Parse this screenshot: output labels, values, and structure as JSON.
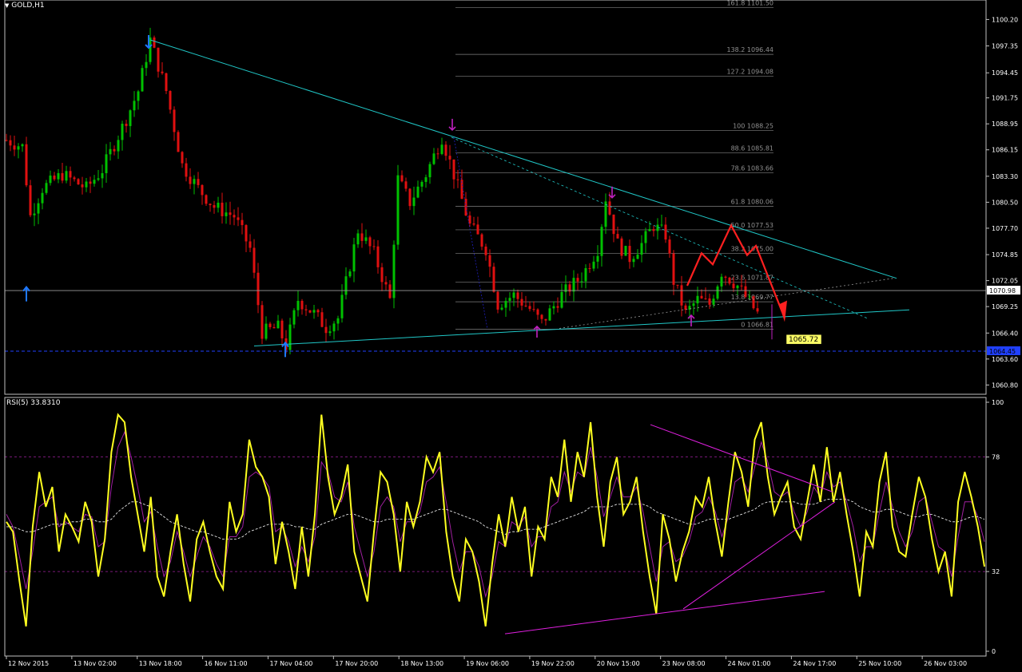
{
  "colors": {
    "background": "#000000",
    "frame": "#c0c0c0",
    "bull": "#00c000",
    "bear": "#e01010",
    "trendline": "#20c8c8",
    "fibo": "#808080",
    "projection": "#ff2020",
    "rsi": "#ffff20",
    "rsi_signal": "#a020a0",
    "rsi_slow": "#008000",
    "rsi_triangle": "#e020e0",
    "level_lines": "#a020a0",
    "current_price_bg": "#ffffff",
    "label_bg": "#ffff66",
    "arrow_up": "#1e78ff",
    "arrow_down": "#c020c0"
  },
  "header": {
    "symbol_label": "GOLD,H1",
    "rsi_label": "RSI(5) 33.8310"
  },
  "price_axis": {
    "ticks": [
      "1100.20",
      "1097.35",
      "1094.45",
      "1091.75",
      "1088.95",
      "1086.15",
      "1083.30",
      "1080.50",
      "1077.70",
      "1074.85",
      "1072.05",
      "1069.25",
      "1066.40",
      "1063.60",
      "1060.80"
    ],
    "current_price": "1070.98",
    "dashed_level_price": "1064.45",
    "marker_label": "1065.72"
  },
  "rsi_axis": {
    "ticks": [
      "100",
      "78",
      "32",
      "0"
    ],
    "upper_level": 78,
    "lower_level": 32
  },
  "time_axis": {
    "labels": [
      "12 Nov 2015",
      "13 Nov 02:00",
      "13 Nov 18:00",
      "16 Nov 11:00",
      "17 Nov 04:00",
      "17 Nov 20:00",
      "18 Nov 13:00",
      "19 Nov 06:00",
      "19 Nov 22:00",
      "20 Nov 15:00",
      "23 Nov 08:00",
      "24 Nov 01:00",
      "24 Nov 17:00",
      "25 Nov 10:00",
      "26 Nov 03:00"
    ]
  },
  "fibo_levels": [
    {
      "label": "161.8  1101.50",
      "price": 1101.5
    },
    {
      "label": "138.2  1096.44",
      "price": 1096.44
    },
    {
      "label": "127.2  1094.08",
      "price": 1094.08
    },
    {
      "label": "100  1088.25",
      "price": 1088.25
    },
    {
      "label": "88.6  1085.81",
      "price": 1085.81
    },
    {
      "label": "78.6  1083.66",
      "price": 1083.66
    },
    {
      "label": "61.8  1080.06",
      "price": 1080.06
    },
    {
      "label": "50.0  1077.53",
      "price": 1077.53
    },
    {
      "label": "38.2  1075.00",
      "price": 1075.0
    },
    {
      "label": "23.6  1071.87",
      "price": 1071.87
    },
    {
      "label": "13.8  1069.77",
      "price": 1069.77
    },
    {
      "label": "0  1066.81",
      "price": 1066.81
    }
  ],
  "chart_data": [
    {
      "type": "candlestick",
      "title": "GOLD,H1",
      "ylim": [
        1059.8,
        1102.3
      ],
      "bars": 161,
      "anchors": [
        {
          "i": 0,
          "p": 1087.2
        },
        {
          "i": 4,
          "p": 1086.5
        },
        {
          "i": 6,
          "p": 1079.0
        },
        {
          "i": 9,
          "p": 1082.0
        },
        {
          "i": 14,
          "p": 1083.5
        },
        {
          "i": 20,
          "p": 1082.0
        },
        {
          "i": 24,
          "p": 1084.0
        },
        {
          "i": 30,
          "p": 1089.5
        },
        {
          "i": 33,
          "p": 1092.5
        },
        {
          "i": 36,
          "p": 1098.0
        },
        {
          "i": 40,
          "p": 1092.5
        },
        {
          "i": 44,
          "p": 1084.5
        },
        {
          "i": 48,
          "p": 1082.0
        },
        {
          "i": 52,
          "p": 1080.0
        },
        {
          "i": 57,
          "p": 1079.0
        },
        {
          "i": 61,
          "p": 1075.5
        },
        {
          "i": 64,
          "p": 1066.5
        },
        {
          "i": 68,
          "p": 1067.0
        },
        {
          "i": 70,
          "p": 1065.0
        },
        {
          "i": 73,
          "p": 1070.0
        },
        {
          "i": 77,
          "p": 1068.5
        },
        {
          "i": 80,
          "p": 1067.0
        },
        {
          "i": 83,
          "p": 1068.0
        },
        {
          "i": 88,
          "p": 1077.5
        },
        {
          "i": 92,
          "p": 1075.0
        },
        {
          "i": 96,
          "p": 1070.0
        },
        {
          "i": 98,
          "p": 1083.0
        },
        {
          "i": 101,
          "p": 1080.5
        },
        {
          "i": 105,
          "p": 1083.5
        },
        {
          "i": 109,
          "p": 1087.5
        },
        {
          "i": 112,
          "p": 1083.5
        },
        {
          "i": 116,
          "p": 1078.0
        },
        {
          "i": 120,
          "p": 1075.5
        },
        {
          "i": 123,
          "p": 1069.5
        },
        {
          "i": 127,
          "p": 1070.5
        },
        {
          "i": 131,
          "p": 1069.0
        },
        {
          "i": 134,
          "p": 1067.5
        },
        {
          "i": 139,
          "p": 1070.5
        },
        {
          "i": 144,
          "p": 1072.5
        },
        {
          "i": 148,
          "p": 1075.5
        },
        {
          "i": 150,
          "p": 1081.0
        },
        {
          "i": 153,
          "p": 1076.0
        },
        {
          "i": 156,
          "p": 1074.5
        },
        {
          "i": 159,
          "p": 1076.0
        },
        {
          "i": 162,
          "p": 1078.0
        },
        {
          "i": 165,
          "p": 1077.0
        },
        {
          "i": 167,
          "p": 1072.0
        },
        {
          "i": 170,
          "p": 1068.5
        },
        {
          "i": 173,
          "p": 1070.0
        },
        {
          "i": 176,
          "p": 1069.5
        },
        {
          "i": 179,
          "p": 1073.0
        },
        {
          "i": 183,
          "p": 1071.5
        },
        {
          "i": 188,
          "p": 1068.5
        }
      ]
    },
    {
      "type": "line",
      "title": "RSI(5) 33.8310",
      "ylim": [
        0,
        100
      ],
      "levels": [
        78,
        32
      ],
      "series": [
        {
          "values": [
            52,
            48,
            28,
            10,
            50,
            72,
            58,
            66,
            40,
            55,
            50,
            44,
            60,
            52,
            30,
            45,
            80,
            95,
            92,
            70,
            55,
            40,
            62,
            30,
            22,
            40,
            55,
            35,
            20,
            45,
            52,
            40,
            30,
            25,
            60,
            48,
            55,
            85,
            74,
            70,
            62,
            35,
            52,
            40,
            25,
            50,
            30,
            55,
            95,
            70,
            55,
            62,
            75,
            40,
            30,
            20,
            48,
            72,
            68,
            55,
            32,
            60,
            50,
            60,
            78,
            72,
            80,
            48,
            30,
            20,
            45,
            40,
            28,
            10,
            35,
            55,
            42,
            62,
            48,
            58,
            30,
            50,
            45,
            70,
            62,
            85,
            60,
            80,
            70,
            92,
            62,
            42,
            68,
            78,
            55,
            60,
            70,
            48,
            30,
            15,
            55,
            45,
            28,
            40,
            48,
            62,
            58,
            70,
            52,
            38,
            60,
            80,
            72,
            58,
            85,
            92,
            70,
            55,
            62,
            68,
            50,
            45,
            60,
            75,
            60,
            82,
            60,
            72,
            55,
            40,
            22,
            48,
            42,
            68,
            80,
            50,
            40,
            38,
            55,
            70,
            62,
            45,
            32,
            40,
            22,
            60,
            72,
            62,
            50,
            34
          ]
        },
        {
          "values": [
            55,
            50,
            38,
            25,
            40,
            58,
            60,
            62,
            50,
            52,
            50,
            48,
            55,
            54,
            42,
            44,
            66,
            82,
            88,
            78,
            66,
            52,
            56,
            42,
            30,
            36,
            48,
            40,
            30,
            38,
            46,
            42,
            35,
            30,
            46,
            46,
            50,
            70,
            72,
            70,
            66,
            48,
            50,
            44,
            34,
            42,
            36,
            46,
            76,
            72,
            62,
            60,
            68,
            50,
            40,
            30,
            40,
            58,
            62,
            58,
            44,
            52,
            52,
            56,
            68,
            70,
            74,
            60,
            44,
            32,
            40,
            40,
            34,
            22,
            30,
            44,
            42,
            52,
            50,
            54,
            42,
            46,
            46,
            58,
            60,
            72,
            64,
            72,
            70,
            82,
            70,
            54,
            62,
            70,
            62,
            62,
            66,
            56,
            42,
            28,
            42,
            44,
            36,
            38,
            44,
            54,
            56,
            62,
            56,
            46,
            54,
            68,
            70,
            64,
            74,
            84,
            76,
            64,
            62,
            64,
            56,
            50,
            56,
            66,
            62,
            72,
            66,
            68,
            60,
            50,
            36,
            42,
            42,
            56,
            68,
            58,
            48,
            42,
            48,
            60,
            62,
            52,
            42,
            40,
            30,
            46,
            60,
            60,
            54,
            44
          ]
        },
        {
          "values": [
            50,
            50,
            49,
            48,
            48,
            49,
            50,
            51,
            51,
            51,
            52,
            52,
            53,
            53,
            52,
            52,
            53,
            56,
            58,
            60,
            60,
            59,
            58,
            56,
            54,
            52,
            51,
            50,
            49,
            48,
            48,
            47,
            46,
            45,
            45,
            45,
            46,
            48,
            49,
            50,
            51,
            51,
            51,
            51,
            50,
            50,
            49,
            49,
            51,
            52,
            53,
            54,
            55,
            55,
            54,
            53,
            52,
            52,
            53,
            53,
            53,
            53,
            53,
            54,
            55,
            56,
            57,
            57,
            56,
            55,
            54,
            53,
            52,
            50,
            49,
            48,
            47,
            48,
            48,
            49,
            49,
            49,
            50,
            51,
            52,
            53,
            54,
            55,
            56,
            58,
            58,
            58,
            58,
            59,
            59,
            59,
            59,
            59,
            58,
            56,
            55,
            54,
            53,
            52,
            51,
            51,
            52,
            53,
            53,
            53,
            53,
            54,
            55,
            56,
            57,
            59,
            60,
            60,
            60,
            60,
            60,
            59,
            59,
            59,
            60,
            61,
            61,
            61,
            61,
            60,
            58,
            57,
            56,
            56,
            57,
            57,
            56,
            55,
            54,
            54,
            55,
            55,
            54,
            53,
            52,
            52,
            53,
            54,
            54,
            53
          ]
        }
      ]
    }
  ]
}
